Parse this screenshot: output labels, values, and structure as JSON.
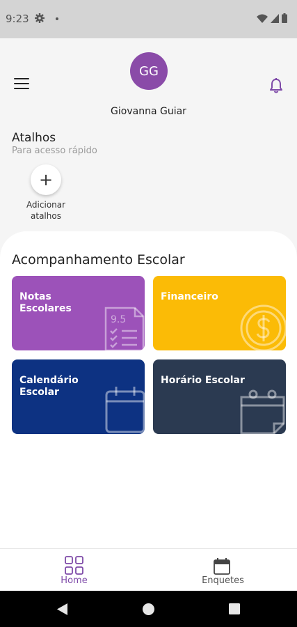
{
  "status_bar": {
    "time": "9:23"
  },
  "header": {
    "avatar_initials": "GG",
    "user_name": "Giovanna Guiar"
  },
  "shortcuts": {
    "title": "Atalhos",
    "subtitle": "Para acesso rápido",
    "add_line1": "Adicionar",
    "add_line2": "atalhos"
  },
  "school": {
    "title": "Acompanhamento Escolar",
    "cards": [
      {
        "line1": "Notas",
        "line2": "Escolares",
        "color": "#9c52b9",
        "icon": "report-card-icon",
        "icon_text": "9.5"
      },
      {
        "line1": "Financeiro",
        "line2": "",
        "color": "#fbbb06",
        "icon": "dollar-coin-icon"
      },
      {
        "line1": "Calendário",
        "line2": "Escolar",
        "color": "#0d3282",
        "icon": "calendar-icon"
      },
      {
        "line1": "Horário Escolar",
        "line2": "",
        "color": "#2b3a51",
        "icon": "schedule-icon"
      }
    ]
  },
  "bottom_nav": {
    "home_label": "Home",
    "polls_label": "Enquetes",
    "active_color": "#7e4aa8"
  }
}
